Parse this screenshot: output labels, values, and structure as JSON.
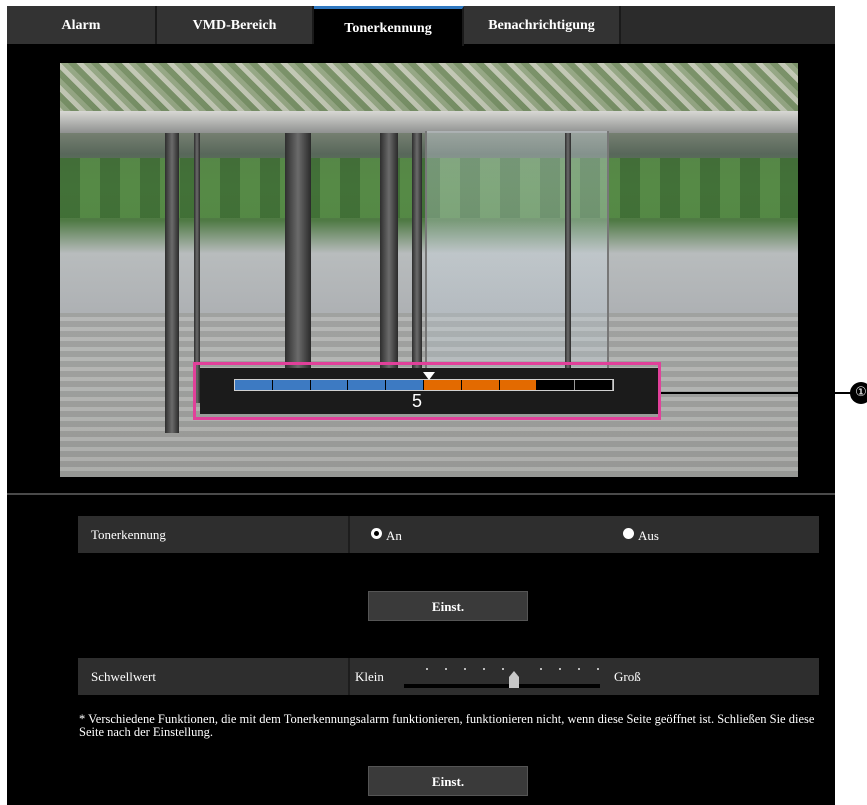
{
  "tabs": [
    {
      "label": "Alarm",
      "active": false
    },
    {
      "label": "VMD-Bereich",
      "active": false
    },
    {
      "label": "Tonerkennung",
      "active": true
    },
    {
      "label": "Benachrichtigung",
      "active": false
    }
  ],
  "overlay": {
    "level_value": "5",
    "segments": [
      "blue",
      "blue",
      "blue",
      "blue",
      "blue",
      "orange",
      "orange",
      "orange",
      "black",
      "black"
    ]
  },
  "callout": {
    "label": "①"
  },
  "tonerkennung": {
    "label": "Tonerkennung",
    "options": [
      {
        "label": "An",
        "selected": true
      },
      {
        "label": "Aus",
        "selected": false
      }
    ]
  },
  "set_button_1": "Einst.",
  "schwellwert": {
    "label": "Schwellwert",
    "min_label": "Klein",
    "max_label": "Groß",
    "level_fraction": 0.55
  },
  "note": "* Verschiedene Funktionen, die mit dem Tonerkennungsalarm funktionieren, funktionieren nicht, wenn diese Seite geöffnet ist. Schließen Sie diese Seite nach der Einstellung.",
  "set_button_2": "Einst.",
  "colors": {
    "active_tab_accent": "#2f78c0",
    "highlight_box": "#e1409a",
    "level_blue": "#3d7ac2",
    "level_orange": "#e36a00"
  }
}
